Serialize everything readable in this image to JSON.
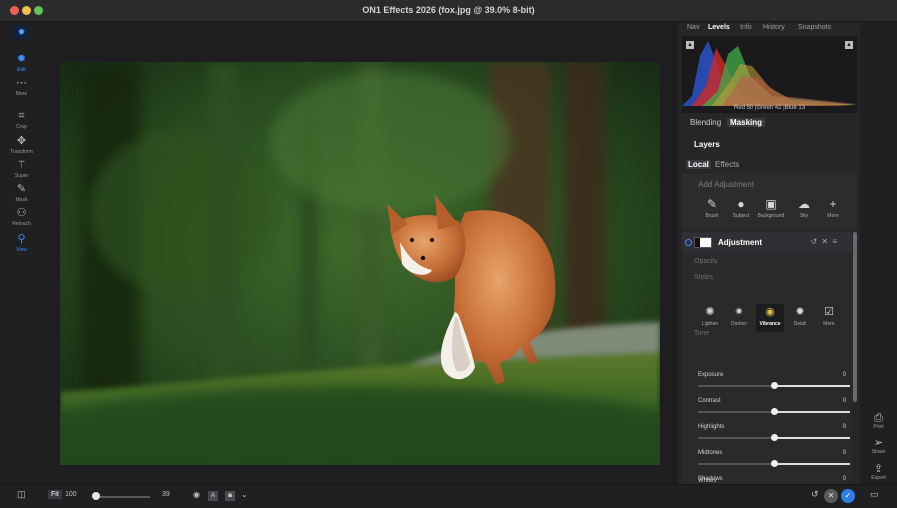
{
  "window": {
    "title": "ON1 Effects 2026 (fox.jpg @ 39.0% 8-bit)"
  },
  "tools": [
    {
      "label": "Edit",
      "icon": "gear-icon",
      "glyph": "✹",
      "active": true
    },
    {
      "label": "More",
      "icon": "more-icon",
      "glyph": "⋯",
      "active": false
    },
    {
      "label": "Crop",
      "icon": "crop-icon",
      "glyph": "⌗",
      "active": false
    },
    {
      "label": "Transform",
      "icon": "move-icon",
      "glyph": "✥",
      "active": false
    },
    {
      "label": "Super",
      "icon": "wand-icon",
      "glyph": "⚚",
      "active": false
    },
    {
      "label": "Mask",
      "icon": "brush-icon",
      "glyph": "✎",
      "active": false
    },
    {
      "label": "Retouch",
      "icon": "retouch-icon",
      "glyph": "⚇",
      "active": false
    },
    {
      "label": "View",
      "icon": "zoom-icon",
      "glyph": "⚲",
      "active": true
    }
  ],
  "panel": {
    "top_tabs": [
      "Nav",
      "Levels",
      "Info",
      "History",
      "Snapshots"
    ],
    "top_tab_selected": "Levels",
    "histogram": {
      "readout": "Red  50  |Green  42  |Blue  13"
    },
    "mode_tabs": [
      "Blending",
      "Masking"
    ],
    "mode_selected": "Masking",
    "layers_title": "Layers",
    "sub_tabs": [
      "Local",
      "Effects"
    ],
    "sub_selected": "Local",
    "add_adjustment": {
      "title": "Add Adjustment",
      "items": [
        {
          "label": "Brush",
          "icon": "brush-icon",
          "glyph": "✎"
        },
        {
          "label": "Subject",
          "icon": "person-icon",
          "glyph": "●"
        },
        {
          "label": "Background",
          "icon": "background-icon",
          "glyph": "▣"
        },
        {
          "label": "Sky",
          "icon": "sky-icon",
          "glyph": "☁"
        },
        {
          "label": "More",
          "icon": "plus-icon",
          "glyph": "+"
        }
      ]
    },
    "adjustment": {
      "name": "Adjustment",
      "controls": "↺ ✕ ≡",
      "opacity_label": "Opacity",
      "styles_label": "Styles",
      "styles": [
        {
          "label": "Lighten",
          "icon": "sun-icon",
          "glyph": "✺",
          "selected": false
        },
        {
          "label": "Darken",
          "icon": "darken-icon",
          "glyph": "✷",
          "selected": false
        },
        {
          "label": "Vibrance",
          "icon": "color-wheel-icon",
          "glyph": "◉",
          "selected": true
        },
        {
          "label": "Detail",
          "icon": "detail-icon",
          "glyph": "✸",
          "selected": false
        },
        {
          "label": "More",
          "icon": "check-box-icon",
          "glyph": "☑",
          "selected": false
        }
      ],
      "tone_label": "Tone",
      "sliders": [
        {
          "label": "Exposure",
          "value": "0",
          "position": 0.5
        },
        {
          "label": "Contrast",
          "value": "0",
          "position": 0.5
        },
        {
          "label": "Highlights",
          "value": "0",
          "position": 0.5
        },
        {
          "label": "Midtones",
          "value": "0",
          "position": 0.5
        },
        {
          "label": "Shadows",
          "value": "0",
          "position": 0.5
        }
      ],
      "next_label": "Whites"
    }
  },
  "right_rail": [
    {
      "label": "Print",
      "icon": "print-icon",
      "glyph": "⎙"
    },
    {
      "label": "Share",
      "icon": "share-icon",
      "glyph": "➢"
    },
    {
      "label": "Export",
      "icon": "export-icon",
      "glyph": "⇪"
    }
  ],
  "bottom": {
    "fit_label": "Fit",
    "zoom_value": "100",
    "zoom_field": "39",
    "zoom_position": 0.0
  }
}
